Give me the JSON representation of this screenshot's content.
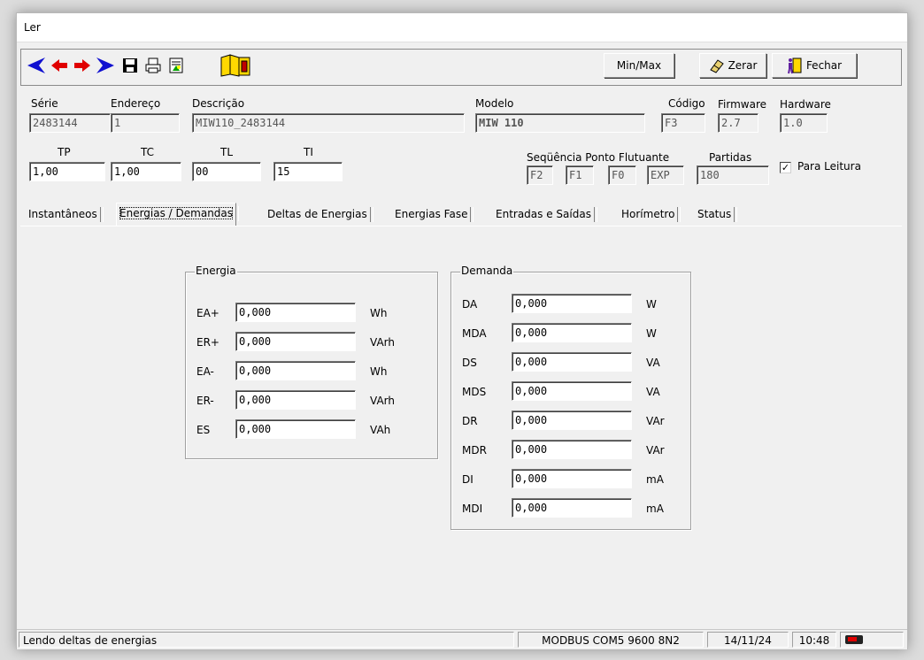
{
  "window": {
    "title": "Ler"
  },
  "toolbar": {
    "minmax_label": "Min/Max",
    "zerar_label": "Zerar",
    "fechar_label": "Fechar"
  },
  "device": {
    "serie_label": "Série",
    "serie_value": "2483144",
    "endereco_label": "Endereço",
    "endereco_value": "1",
    "descricao_label": "Descrição",
    "descricao_value": "MIW110_2483144",
    "modelo_label": "Modelo",
    "modelo_value": "MIW 110",
    "codigo_label": "Código",
    "codigo_value": "F3",
    "firmware_label": "Firmware",
    "firmware_value": "2.7",
    "hardware_label": "Hardware",
    "hardware_value": "1.0",
    "tp_label": "TP",
    "tp_value": "1,00",
    "tc_label": "TC",
    "tc_value": "1,00",
    "tl_label": "TL",
    "tl_value": "00",
    "ti_label": "TI",
    "ti_value": "15",
    "sequencia_label": "Seqüência Ponto Flutuante",
    "sequencia_values": [
      "F2",
      "F1",
      "F0",
      "EXP"
    ],
    "partidas_label": "Partidas",
    "partidas_value": "180",
    "para_leitura_label": "Para Leitura",
    "para_leitura_checked": true
  },
  "tabs": [
    {
      "label": "Instantâneos"
    },
    {
      "label": "Energias / Demandas"
    },
    {
      "label": "Deltas de Energias"
    },
    {
      "label": "Energias Fase"
    },
    {
      "label": "Entradas e Saídas"
    },
    {
      "label": "Horímetro"
    },
    {
      "label": "Status"
    }
  ],
  "active_tab": "Energias / Demandas",
  "energia": {
    "title": "Energia",
    "rows": [
      {
        "label": "EA+",
        "value": "0,000",
        "unit": "Wh"
      },
      {
        "label": "ER+",
        "value": "0,000",
        "unit": "VArh"
      },
      {
        "label": "EA-",
        "value": "0,000",
        "unit": "Wh"
      },
      {
        "label": "ER-",
        "value": "0,000",
        "unit": "VArh"
      },
      {
        "label": "ES",
        "value": "0,000",
        "unit": "VAh"
      }
    ]
  },
  "demanda": {
    "title": "Demanda",
    "rows": [
      {
        "label": "DA",
        "value": "0,000",
        "unit": "W"
      },
      {
        "label": "MDA",
        "value": "0,000",
        "unit": "W"
      },
      {
        "label": "DS",
        "value": "0,000",
        "unit": "VA"
      },
      {
        "label": "MDS",
        "value": "0,000",
        "unit": "VA"
      },
      {
        "label": "DR",
        "value": "0,000",
        "unit": "VAr"
      },
      {
        "label": "MDR",
        "value": "0,000",
        "unit": "VAr"
      },
      {
        "label": "DI",
        "value": "0,000",
        "unit": "mA"
      },
      {
        "label": "MDI",
        "value": "0,000",
        "unit": "mA"
      }
    ]
  },
  "status": {
    "message": "Lendo deltas de energias",
    "connection": "MODBUS COM5 9600 8N2",
    "date": "14/11/24",
    "time": "10:48"
  },
  "colors": {
    "arrow_blue": "#1010d0",
    "arrow_red": "#e00000",
    "book_yellow": "#ffd800"
  }
}
